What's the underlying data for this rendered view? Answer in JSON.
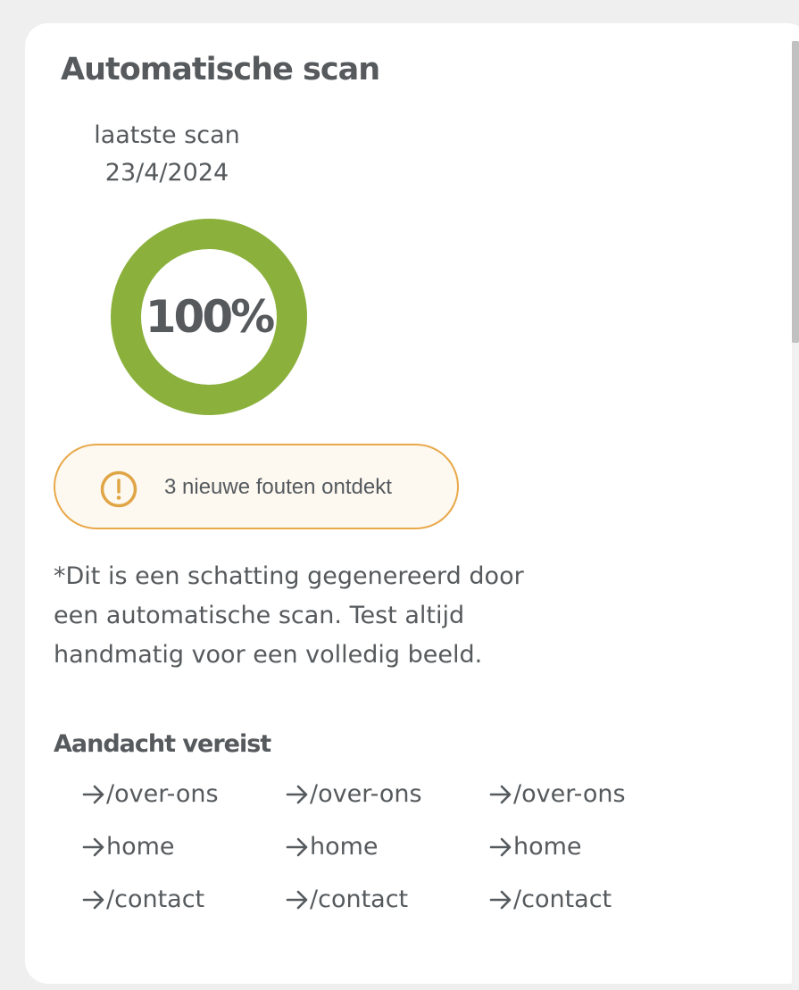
{
  "card": {
    "title": "Automatische scan",
    "last_scan_label": "laatste scan",
    "last_scan_date": "23/4/2024",
    "score": {
      "label": "100%",
      "percent": 100,
      "ring_color": "#8bb13c"
    },
    "alert": {
      "icon": "exclamation-circle-icon",
      "text": "3 nieuwe fouten ontdekt",
      "border_color": "#e8a94a"
    },
    "disclaimer": "*Dit is een schatting gegenereerd door een automatische scan. Test altijd handmatig voor een volledig beeld.",
    "attention": {
      "heading": "Aandacht vereist",
      "link_icon": "arrow-right-icon",
      "links": [
        [
          "/over-ons",
          "/over-ons",
          "/over-ons"
        ],
        [
          "home",
          "home",
          "home"
        ],
        [
          "/contact",
          "/contact",
          "/contact"
        ]
      ]
    }
  }
}
